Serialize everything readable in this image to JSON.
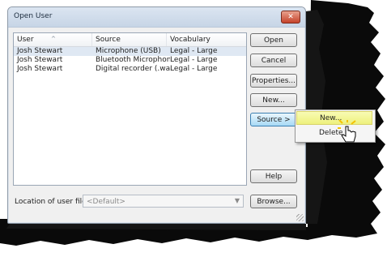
{
  "dialog": {
    "title": "Open User",
    "close_label": "✕"
  },
  "list": {
    "columns": [
      "User",
      "Source",
      "Vocabulary"
    ],
    "sort_indicator": "^",
    "rows": [
      {
        "user": "Josh Stewart",
        "source": "Microphone (USB)",
        "vocabulary": "Legal - Large"
      },
      {
        "user": "Josh Stewart",
        "source": "Bluetooth Microphone",
        "vocabulary": "Legal - Large"
      },
      {
        "user": "Josh Stewart",
        "source": "Digital recorder (.wa...",
        "vocabulary": "Legal - Large"
      }
    ]
  },
  "buttons": {
    "open": "Open",
    "cancel": "Cancel",
    "properties": "Properties...",
    "new": "New...",
    "source": "Source >",
    "help": "Help",
    "browse": "Browse..."
  },
  "location": {
    "label": "Location of user files:",
    "value": "<Default>"
  },
  "source_menu": {
    "items": [
      "New...",
      "Delete"
    ]
  }
}
